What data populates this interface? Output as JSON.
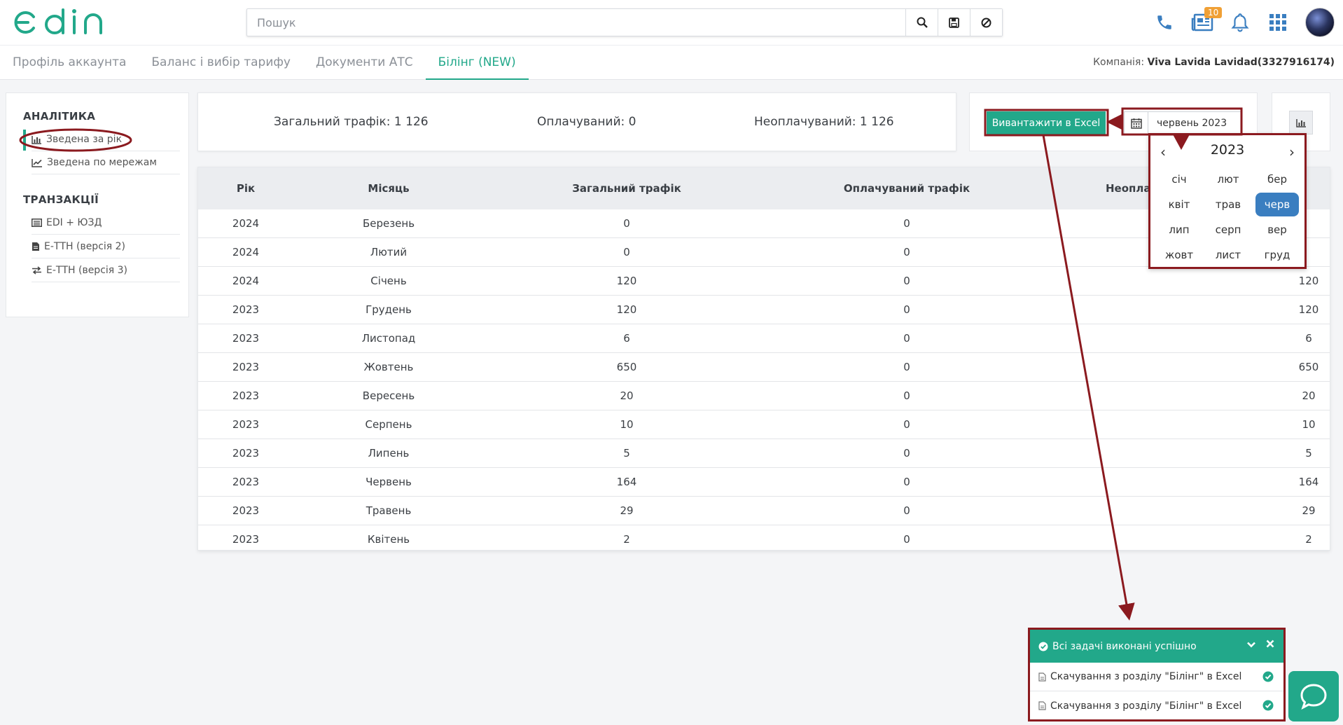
{
  "brand": {
    "logo_text": "edin",
    "accent": "#22a88a",
    "annotation_color": "#8b1a1f"
  },
  "search": {
    "placeholder": "Пошук",
    "icons": [
      "search-icon",
      "save-icon",
      "clear-filter-icon"
    ]
  },
  "header": {
    "icons": [
      "phone-icon",
      "news-icon",
      "bell-icon",
      "apps-grid-icon",
      "avatar"
    ],
    "news_badge": "10"
  },
  "tabs": [
    {
      "label": "Профіль аккаунта",
      "active": false
    },
    {
      "label": "Баланс і вибір тарифу",
      "active": false
    },
    {
      "label": "Документи АТС",
      "active": false
    },
    {
      "label": "Білінг (NEW)",
      "active": true
    }
  ],
  "company": {
    "label": "Компанія:",
    "value": "Viva Lavida Lavidad(3327916174)"
  },
  "sidebar": {
    "analytics_heading": "АНАЛІТИКА",
    "analytics_items": [
      {
        "label": "Зведена за рік",
        "icon": "bar-chart-icon",
        "active": true
      },
      {
        "label": "Зведена по мережам",
        "icon": "line-chart-icon",
        "active": false
      }
    ],
    "transactions_heading": "ТРАНЗАКЦІЇ",
    "transactions_items": [
      {
        "label": "EDI + ЮЗД",
        "icon": "list-icon"
      },
      {
        "label": "Е-ТТН (версія 2)",
        "icon": "document-icon"
      },
      {
        "label": "Е-ТТН (версія 3)",
        "icon": "exchange-icon"
      }
    ]
  },
  "stats": {
    "total": "Загальний трафік: 1 126",
    "paid": "Оплачуваний: 0",
    "unpaid": "Неоплачуваний: 1 126"
  },
  "export": {
    "button_label": "Вивантажити в Excel",
    "date_value": "червень 2023"
  },
  "table": {
    "headers": [
      "Рік",
      "Місяць",
      "Загальний трафік",
      "Оплачуваний трафік",
      "Неоплачуваний трафік"
    ],
    "header_visible": [
      "Рік",
      "Місяць",
      "Загальний трафік",
      "Оплачуваний трафік",
      "Неоплач"
    ],
    "rows": [
      [
        "2024",
        "Березень",
        "0",
        "0",
        ""
      ],
      [
        "2024",
        "Лютий",
        "0",
        "0",
        ""
      ],
      [
        "2024",
        "Січень",
        "120",
        "0",
        "120"
      ],
      [
        "2023",
        "Грудень",
        "120",
        "0",
        "120"
      ],
      [
        "2023",
        "Листопад",
        "6",
        "0",
        "6"
      ],
      [
        "2023",
        "Жовтень",
        "650",
        "0",
        "650"
      ],
      [
        "2023",
        "Вересень",
        "20",
        "0",
        "20"
      ],
      [
        "2023",
        "Серпень",
        "10",
        "0",
        "10"
      ],
      [
        "2023",
        "Липень",
        "5",
        "0",
        "5"
      ],
      [
        "2023",
        "Червень",
        "164",
        "0",
        "164"
      ],
      [
        "2023",
        "Травень",
        "29",
        "0",
        "29"
      ],
      [
        "2023",
        "Квітень",
        "2",
        "0",
        "2"
      ]
    ]
  },
  "picker": {
    "year": "2023",
    "prev": "‹",
    "next": "›",
    "months": [
      "січ",
      "лют",
      "бер",
      "квіт",
      "трав",
      "черв",
      "лип",
      "серп",
      "вер",
      "жовт",
      "лист",
      "груд"
    ],
    "selected": "черв"
  },
  "notification": {
    "title": "Всі задачі виконані успішно",
    "items": [
      "Скачування з розділу \"Білінг\" в Excel",
      "Скачування з розділу \"Білінг\" в Excel"
    ]
  }
}
